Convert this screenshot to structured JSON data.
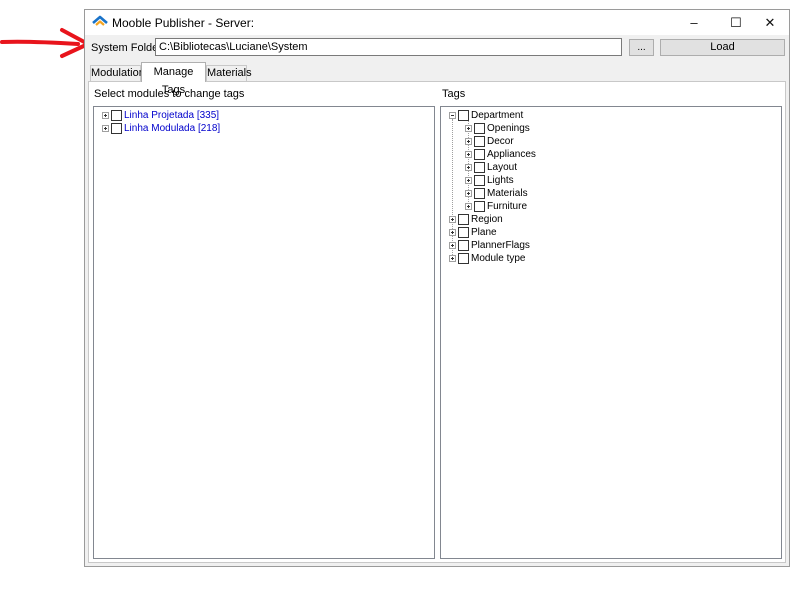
{
  "window": {
    "title": "Mooble Publisher - Server:",
    "minimize_glyph": "–",
    "maximize_glyph": "☐",
    "close_glyph": "✕"
  },
  "system_folder": {
    "label": "System Folder:",
    "value": "C:\\Bibliotecas\\Luciane\\System",
    "browse_label": "...",
    "load_label": "Load"
  },
  "tabs": [
    {
      "label": "Modulation"
    },
    {
      "label": "Manage Tags",
      "selected": true
    },
    {
      "label": "Materials"
    }
  ],
  "left_panel": {
    "heading": "Select modules to change tags",
    "items": [
      {
        "label": "Linha Projetada [335]"
      },
      {
        "label": "Linha Modulada [218]"
      }
    ]
  },
  "right_panel": {
    "heading": "Tags",
    "root": {
      "label": "Department"
    },
    "department_children": [
      {
        "label": "Openings"
      },
      {
        "label": "Decor"
      },
      {
        "label": "Appliances"
      },
      {
        "label": "Layout"
      },
      {
        "label": "Lights"
      },
      {
        "label": "Materials"
      },
      {
        "label": "Furniture"
      }
    ],
    "other_roots": [
      {
        "label": "Region"
      },
      {
        "label": "Plane"
      },
      {
        "label": "PlannerFlags"
      },
      {
        "label": "Module type"
      }
    ]
  },
  "colors": {
    "annotation_arrow": "#e8141c",
    "link_text": "#0000cc",
    "app_icon_primary": "#1a73c9",
    "app_icon_secondary": "#f5a623"
  },
  "icons": {
    "app": "house-icon",
    "annotation": "red-arrow-icon"
  }
}
